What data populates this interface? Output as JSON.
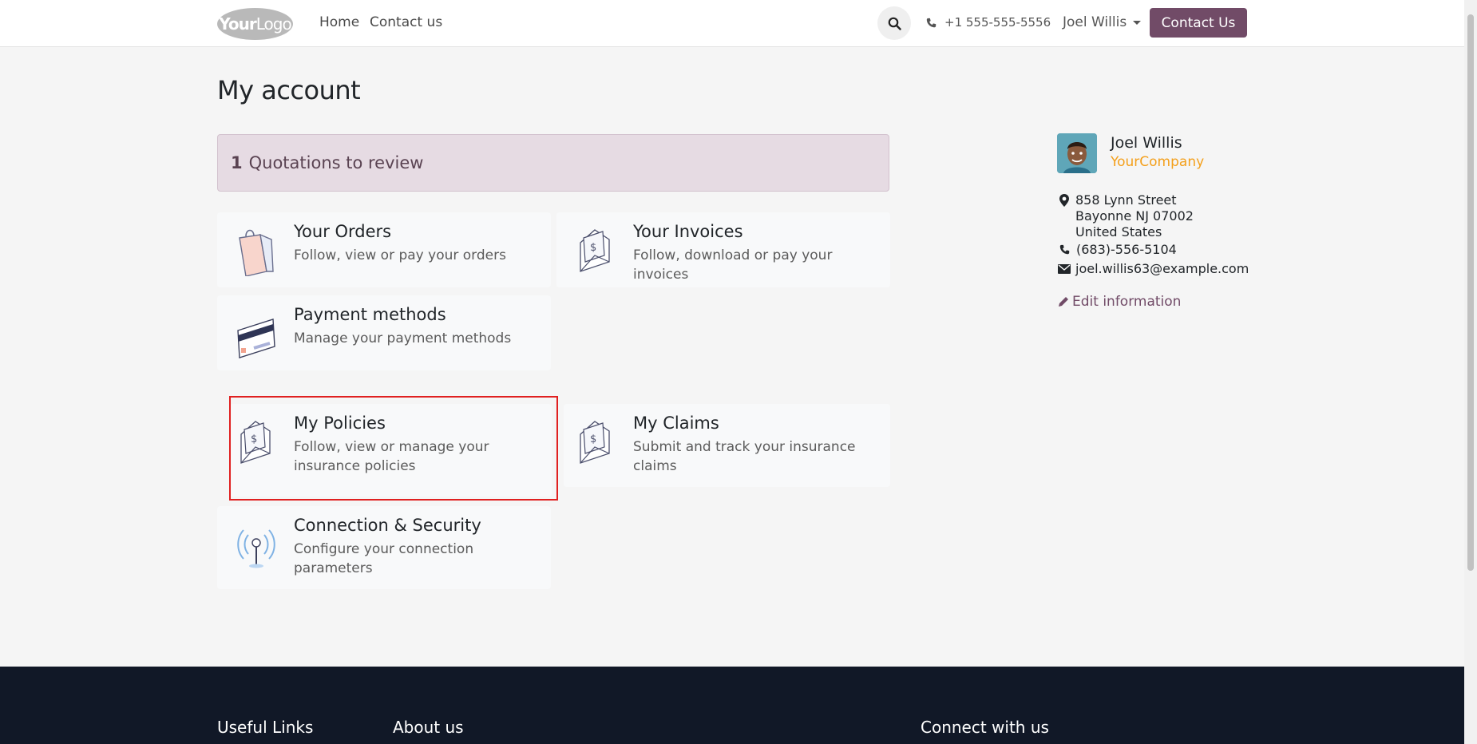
{
  "header": {
    "logo": {
      "part1": "Your",
      "part2": "Logo"
    },
    "nav": [
      {
        "label": "Home"
      },
      {
        "label": "Contact us"
      }
    ],
    "phone": "+1 555-555-5556",
    "user": "Joel Willis",
    "contact_button": "Contact Us"
  },
  "main": {
    "title": "My account",
    "alert": {
      "count": "1",
      "text": "Quotations to review"
    },
    "cards": [
      {
        "title": "Your Orders",
        "description": "Follow, view or pay your orders",
        "icon": "shopping-bag-icon"
      },
      {
        "title": "Your Invoices",
        "description": "Follow, download or pay your invoices",
        "icon": "invoice-envelope-icon"
      },
      {
        "title": "Payment methods",
        "description": "Manage your payment methods",
        "icon": "credit-card-icon"
      },
      {
        "title": "My Policies",
        "description": "Follow, view or manage your insurance policies",
        "icon": "invoice-envelope-icon"
      },
      {
        "title": "My Claims",
        "description": "Submit and track your insurance claims",
        "icon": "invoice-envelope-icon"
      },
      {
        "title": "Connection & Security",
        "description": "Configure your connection parameters",
        "icon": "antenna-icon"
      }
    ]
  },
  "sidebar": {
    "name": "Joel Willis",
    "company": "YourCompany",
    "address": [
      "858 Lynn Street",
      "Bayonne NJ 07002",
      "United States"
    ],
    "phone": "(683)-556-5104",
    "email": "joel.willis63@example.com",
    "edit_label": "Edit information"
  },
  "footer": {
    "headings": [
      "Useful Links",
      "About us",
      "Connect with us"
    ]
  },
  "colors": {
    "brand": "#714b67",
    "company": "#f4a01c",
    "footer": "#111827",
    "highlight": "#e02020"
  }
}
